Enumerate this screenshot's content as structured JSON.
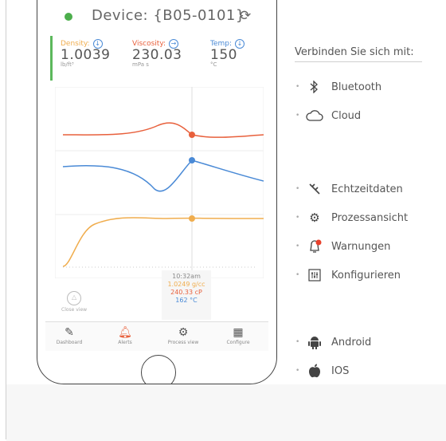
{
  "device": {
    "title": "Device: {B05-0101}"
  },
  "metrics": [
    {
      "label": "Density:",
      "value": "1.0039",
      "unit": "lb/ft³",
      "color": "#f0ad4e"
    },
    {
      "label": "Viscosity:",
      "value": "230.03",
      "unit": "mPa s",
      "color": "#e8603c"
    },
    {
      "label": "Temp:",
      "value": "150",
      "unit": "°C",
      "color": "#4a8ad6"
    }
  ],
  "readout": {
    "time": "10:32am",
    "density": "1.0249 g/cc",
    "viscosity": "240.33 cP",
    "temp": "162 °C"
  },
  "close_view": "Close view",
  "nav": [
    {
      "label": "Dashboard",
      "icon": "dashboard-icon"
    },
    {
      "label": "Alerts",
      "icon": "bell-icon"
    },
    {
      "label": "Process view",
      "icon": "gears-icon"
    },
    {
      "label": "Configure",
      "icon": "sliders-icon"
    }
  ],
  "connect": {
    "title": "Verbinden Sie sich mit:",
    "items": [
      {
        "label": "Bluetooth",
        "icon": "bluetooth-icon"
      },
      {
        "label": "Cloud",
        "icon": "cloud-icon"
      }
    ]
  },
  "features": [
    {
      "label": "Echtzeitdaten",
      "icon": "probe-icon"
    },
    {
      "label": "Prozessansicht",
      "icon": "gears-icon"
    },
    {
      "label": "Warnungen",
      "icon": "bell-alert-icon"
    },
    {
      "label": "Konfigurieren",
      "icon": "sliders-icon"
    }
  ],
  "platforms": [
    {
      "label": "Android",
      "icon": "android-icon"
    },
    {
      "label": "IOS",
      "icon": "apple-icon"
    }
  ],
  "colors": {
    "orange": "#f0ad4e",
    "red": "#e8603c",
    "blue": "#4a8ad6",
    "green": "#5cb85c"
  }
}
